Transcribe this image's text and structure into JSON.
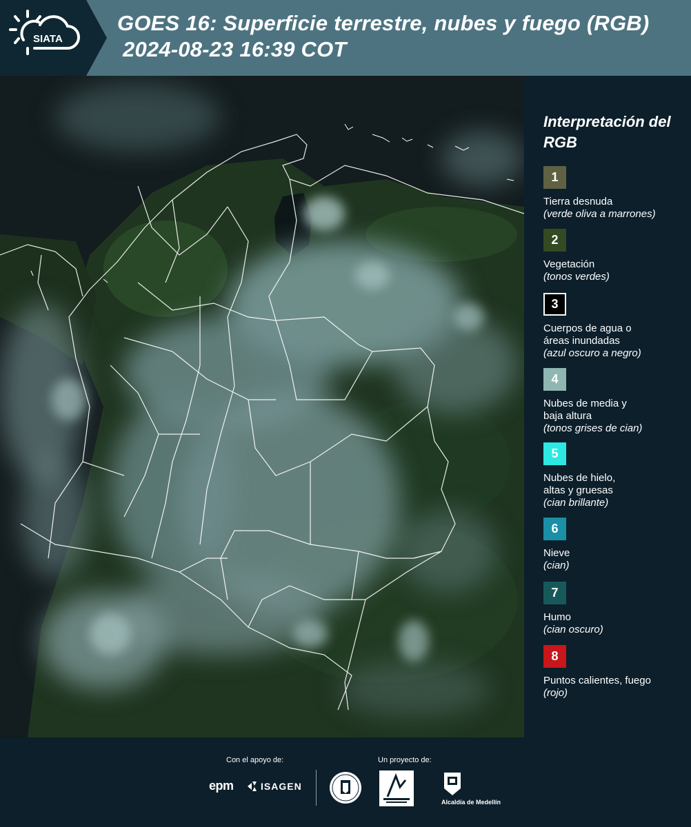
{
  "header": {
    "logo_text": "SIATA",
    "title_line1": "GOES 16: Superficie terrestre, nubes y fuego (RGB)",
    "title_line2": "2024-08-23 16:39 COT"
  },
  "legend": {
    "title": "Interpretación del RGB",
    "items": [
      {
        "number": "1",
        "label": "Tierra desnuda",
        "note": "(verde oliva a marrones)",
        "color": "#5f6142",
        "border": "#5f6142"
      },
      {
        "number": "2",
        "label": "Vegetación",
        "note": "(tonos verdes)",
        "color": "#344a22",
        "border": "#344a22"
      },
      {
        "number": "3",
        "label": "Cuerpos de agua o\náreas inundadas",
        "note": "(azul oscuro a negro)",
        "color": "#000000",
        "border": "#ffffff"
      },
      {
        "number": "4",
        "label": "Nubes de media y\nbaja altura",
        "note": "(tonos grises de cian)",
        "color": "#8fb6b3",
        "border": "#8fb6b3"
      },
      {
        "number": "5",
        "label": "Nubes de hielo,\naltas y gruesas",
        "note": "(cian brillante)",
        "color": "#2de8e2",
        "border": "#2de8e2"
      },
      {
        "number": "6",
        "label": "Nieve",
        "note": "(cian)",
        "color": "#1a8fa6",
        "border": "#1a8fa6"
      },
      {
        "number": "7",
        "label": "Humo",
        "note": "(cian oscuro)",
        "color": "#17595a",
        "border": "#17595a"
      },
      {
        "number": "8",
        "label": "Puntos calientes, fuego",
        "note": "(rojo)",
        "color": "#c8161b",
        "border": "#c8161b"
      }
    ]
  },
  "footer": {
    "support_caption": "Con el apoyo de:",
    "project_caption": "Un proyecto de:",
    "epm_logo": "epm",
    "isagen_logo": "ISAGEN",
    "medellin_caption": "Alcaldía de Medellín"
  },
  "colors": {
    "header_bg": "#4d7380",
    "logo_bg": "#0f2733",
    "panel_bg": "#0c1f2b",
    "border_line": "#ffffff"
  }
}
